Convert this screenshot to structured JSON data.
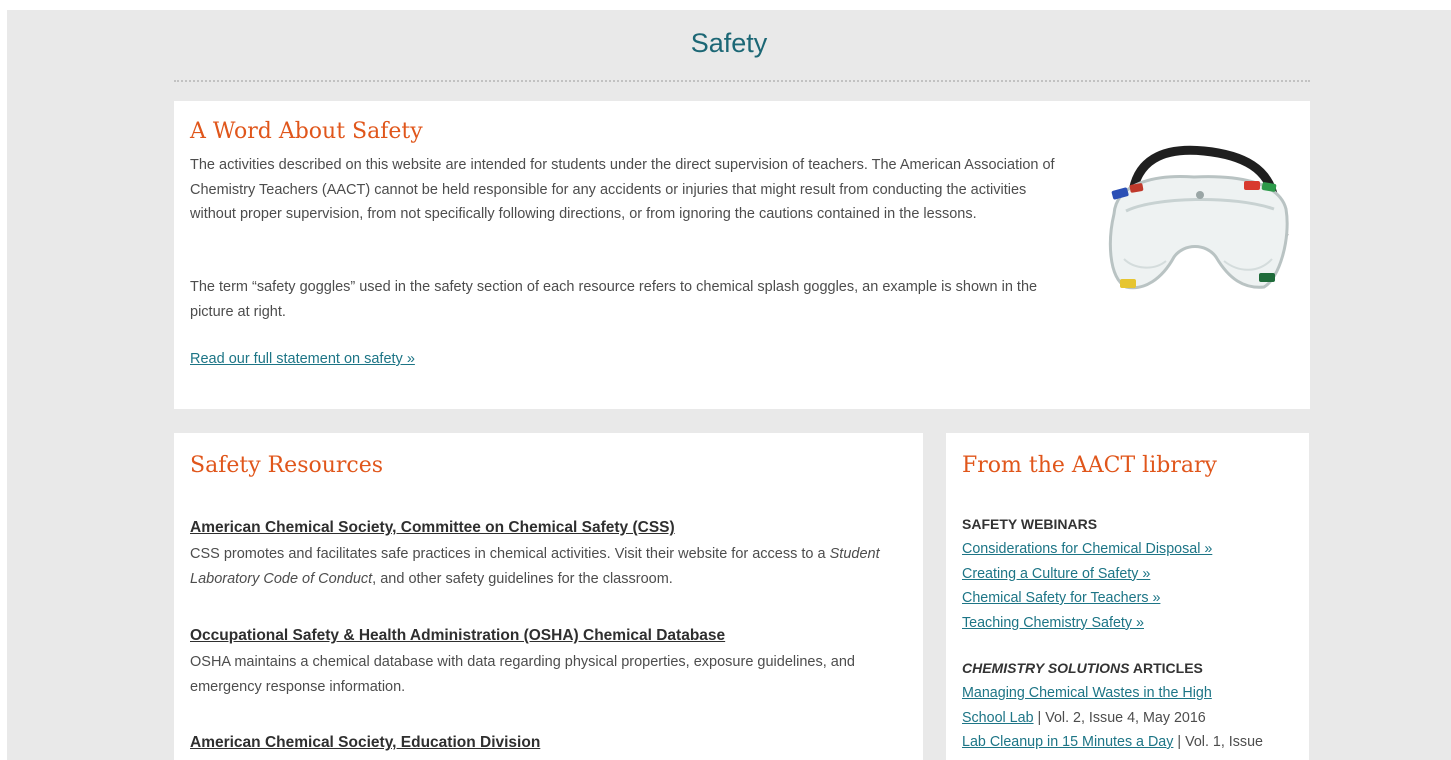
{
  "page": {
    "title": "Safety"
  },
  "word_about_safety": {
    "heading": "A Word About Safety",
    "paragraph1": "The activities described on this website are intended for students under the direct supervision of teachers. The American Association of Chemistry Teachers (AACT) cannot be held responsible for any accidents or injuries that might result from conducting the activities without proper supervision, from not specifically following directions, or from ignoring the cautions contained in the lessons.",
    "paragraph2": "The term “safety goggles” used in the safety section of each resource refers to chemical splash goggles, an example is shown in the picture at right.",
    "link": "Read our full statement on safety »"
  },
  "safety_resources": {
    "heading": "Safety Resources",
    "items": [
      {
        "title": "American Chemical Society, Committee on Chemical Safety (CSS)",
        "desc_before": "CSS promotes and facilitates safe practices in chemical activities.  Visit their website for access to a ",
        "desc_italic": "Student Laboratory Code of Conduct",
        "desc_after": ", and other safety guidelines for the classroom."
      },
      {
        "title": "Occupational Safety & Health Administration (OSHA) Chemical Database",
        "desc": "OSHA maintains a chemical database with data regarding physical properties, exposure guidelines, and emergency response information."
      },
      {
        "title": "American Chemical Society, Education Division"
      }
    ]
  },
  "library": {
    "heading": "From the AACT library",
    "webinars_label": "SAFETY WEBINARS",
    "webinars": [
      "Considerations for Chemical Disposal »",
      "Creating a Culture of Safety »",
      "Chemical Safety for Teachers »",
      "Teaching Chemistry Safety »"
    ],
    "articles_label_italic": "CHEMISTRY SOLUTIONS",
    "articles_label_rest": " ARTICLES",
    "articles": [
      {
        "title_line1": "Managing Chemical Wastes in the High",
        "title_line2": "School Lab",
        "meta": " | Vol. 2, Issue 4, May 2016"
      },
      {
        "title": "Lab Cleanup in 15 Minutes a Day",
        "meta": " | Vol. 1, Issue"
      }
    ]
  },
  "colors": {
    "heading_orange": "#e0561b",
    "link_teal": "#1d7586",
    "title_teal": "#1c6775",
    "background": "#e9e9e9"
  },
  "icons": {
    "goggles_image": "safety-goggles-image"
  }
}
